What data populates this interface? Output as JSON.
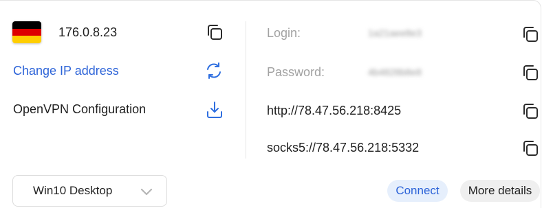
{
  "server": {
    "ip": "176.0.8.23",
    "flag_colors": [
      "#000000",
      "#dd0000",
      "#ffce00"
    ],
    "flag_icon": "germany-flag-icon"
  },
  "actions": {
    "change_ip": "Change IP address",
    "openvpn": "OpenVPN Configuration"
  },
  "credentials": {
    "login_label": "Login:",
    "login_value": "1a21aee8e3",
    "password_label": "Password:",
    "password_value": "4b4828b8e8",
    "http_proxy": "http://78.47.56.218:8425",
    "socks_proxy": "socks5://78.47.56.218:5332"
  },
  "footer": {
    "device_select": "Win10 Desktop",
    "connect_label": "Connect",
    "more_label": "More details"
  },
  "colors": {
    "accent": "#2c63d8",
    "icon_blue": "#2f6fe0",
    "muted_text": "#a2a2a2"
  }
}
